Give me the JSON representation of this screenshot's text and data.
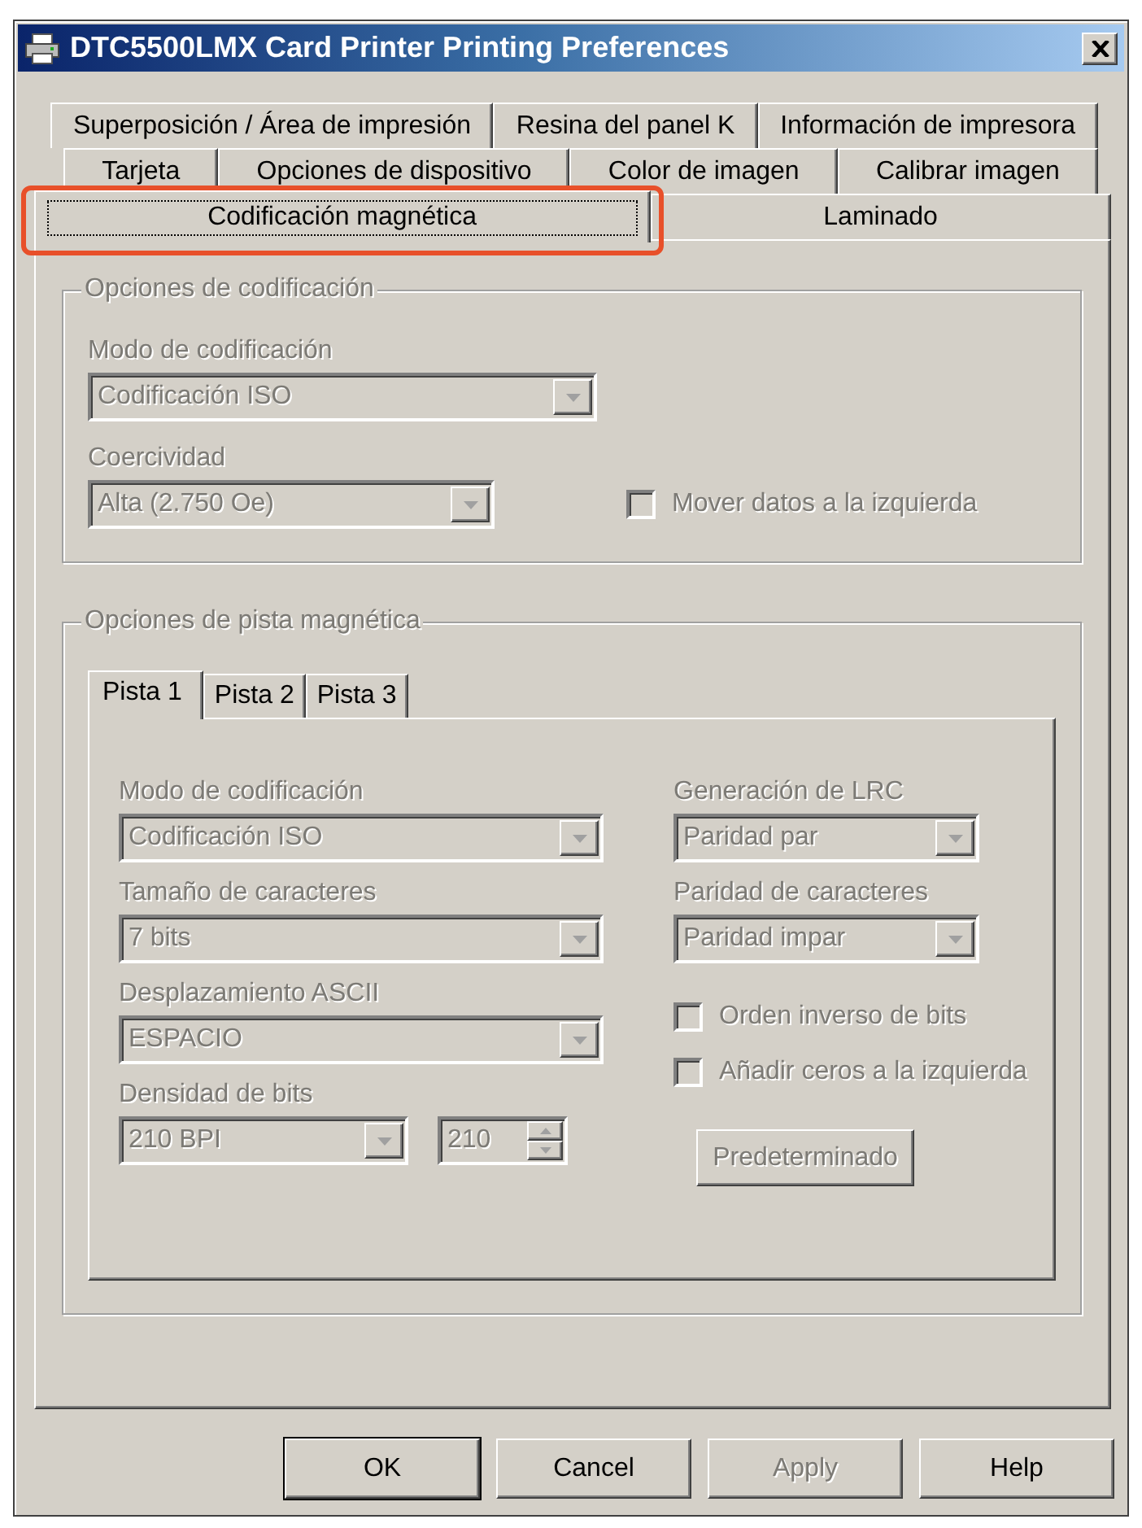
{
  "window": {
    "title": "DTC5500LMX Card Printer Printing Preferences"
  },
  "tab_rows": [
    [
      {
        "label": "Superposición / Área de impresión",
        "selected": false,
        "highlighted": false
      },
      {
        "label": "Resina del panel K",
        "selected": false,
        "highlighted": false
      },
      {
        "label": "Información de impresora",
        "selected": false,
        "highlighted": false
      }
    ],
    [
      {
        "label": "Tarjeta",
        "selected": false,
        "highlighted": false
      },
      {
        "label": "Opciones de dispositivo",
        "selected": false,
        "highlighted": false
      },
      {
        "label": "Color de imagen",
        "selected": false,
        "highlighted": false
      },
      {
        "label": "Calibrar imagen",
        "selected": false,
        "highlighted": false
      }
    ],
    [
      {
        "label": "Codificación magnética",
        "selected": true,
        "highlighted": true
      },
      {
        "label": "Laminado",
        "selected": false,
        "highlighted": false
      }
    ]
  ],
  "encoding_options": {
    "legend": "Opciones de codificación",
    "disabled": true,
    "mode": {
      "label": "Modo de codificación",
      "value": "Codificación ISO"
    },
    "coercivity": {
      "label": "Coercividad",
      "value": "Alta (2.750 Oe)"
    },
    "shift_left": {
      "label": "Mover datos a la izquierda",
      "checked": false
    }
  },
  "track_options": {
    "legend": "Opciones de pista magnética",
    "disabled": true,
    "tabs": [
      {
        "label": "Pista 1",
        "selected": true
      },
      {
        "label": "Pista 2",
        "selected": false
      },
      {
        "label": "Pista 3",
        "selected": false
      }
    ],
    "left": [
      {
        "label": "Modo de codificación",
        "value": "Codificación ISO"
      },
      {
        "label": "Tamaño de caracteres",
        "value": "7 bits"
      },
      {
        "label": "Desplazamiento ASCII",
        "value": "ESPACIO"
      }
    ],
    "density": {
      "label": "Densidad de bits",
      "value": "210 BPI",
      "spin_value": "210"
    },
    "right": [
      {
        "kind": "combo",
        "label": "Generación de LRC",
        "value": "Paridad par"
      },
      {
        "kind": "combo",
        "label": "Paridad de caracteres",
        "value": "Paridad impar"
      },
      {
        "kind": "checkbox",
        "label": "Orden inverso de bits",
        "checked": false
      },
      {
        "kind": "checkbox",
        "label": "Añadir ceros a la izquierda",
        "checked": false
      },
      {
        "kind": "button",
        "label": "Predeterminado"
      }
    ]
  },
  "buttons": [
    {
      "label": "OK",
      "default": true,
      "disabled": false
    },
    {
      "label": "Cancel",
      "default": false,
      "disabled": false
    },
    {
      "label": "Apply",
      "default": false,
      "disabled": true
    },
    {
      "label": "Help",
      "default": false,
      "disabled": false
    }
  ]
}
